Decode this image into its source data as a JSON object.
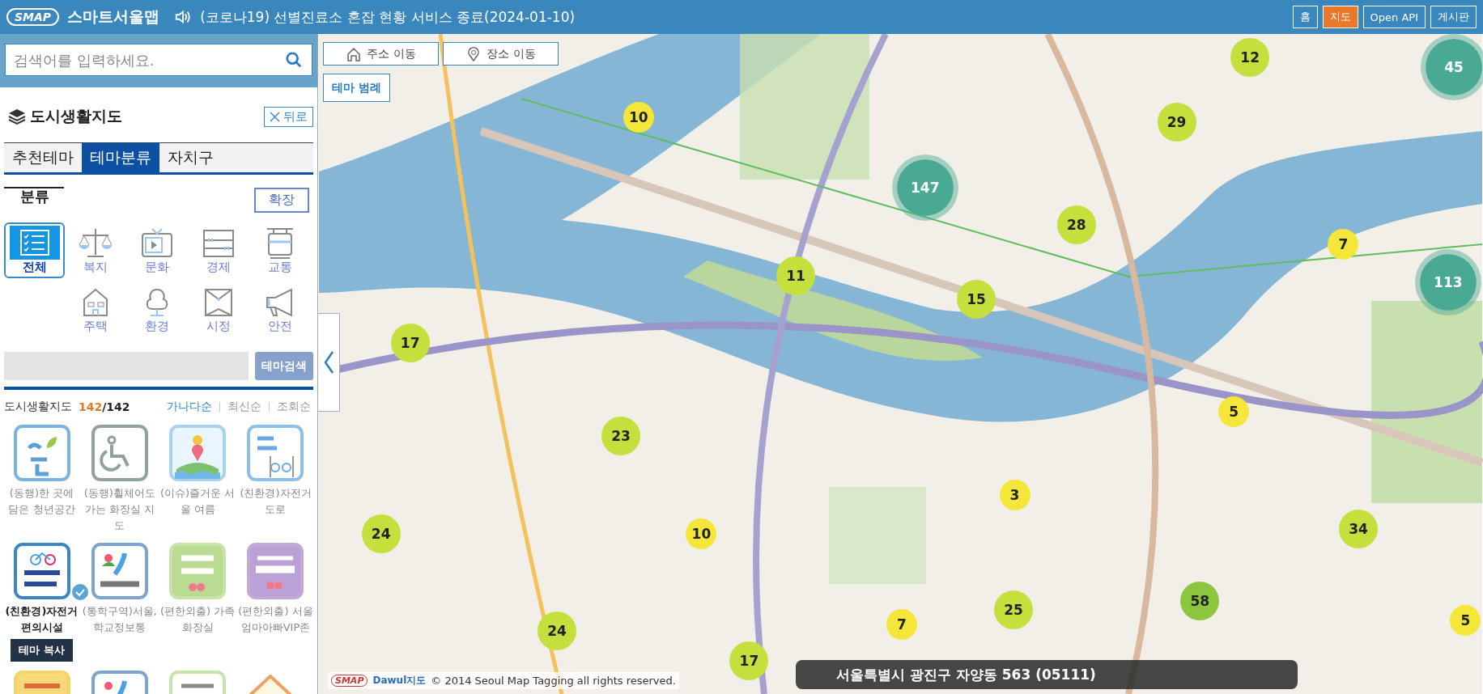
{
  "header": {
    "logo": "SMAP",
    "app_name": "스마트서울맵",
    "notice": "(코로나19) 선별진료소 혼잡 현황 서비스 종료(2024-01-10)",
    "nav": [
      {
        "label": "홈",
        "selected": false
      },
      {
        "label": "지도",
        "selected": true
      },
      {
        "label": "Open API",
        "selected": false
      },
      {
        "label": "게시판",
        "selected": false
      }
    ]
  },
  "sidebar": {
    "search": {
      "placeholder": "검색어를 입력하세요."
    },
    "title": "도시생활지도",
    "back_button": "뒤로",
    "tabs": [
      {
        "label": "추천테마",
        "selected": false
      },
      {
        "label": "테마분류",
        "selected": true
      },
      {
        "label": "자치구",
        "selected": false
      }
    ],
    "category_heading": "분류",
    "expand_button": "확장",
    "categories": [
      {
        "label": "전체",
        "selected": true
      },
      {
        "label": "복지",
        "selected": false
      },
      {
        "label": "문화",
        "selected": false
      },
      {
        "label": "경제",
        "selected": false
      },
      {
        "label": "교통",
        "selected": false
      },
      {
        "label": "주택",
        "selected": false
      },
      {
        "label": "환경",
        "selected": false
      },
      {
        "label": "시정",
        "selected": false
      },
      {
        "label": "안전",
        "selected": false
      }
    ],
    "theme_search": {
      "button": "테마검색"
    },
    "list": {
      "title": "도시생활지도",
      "count": "142",
      "total": "/142",
      "sort": [
        {
          "label": "가나다순",
          "selected": true
        },
        {
          "label": "최신순",
          "selected": false
        },
        {
          "label": "조회순",
          "selected": false
        }
      ]
    },
    "themes": [
      {
        "kind": "theme",
        "title": "(동행)한 곳에 담은 청년공간",
        "selected": false
      },
      {
        "kind": "theme",
        "title": "(동행)휠체어도 가는 화장실 지도",
        "selected": false
      },
      {
        "kind": "theme",
        "title": "(이슈)즐거운 서울 여름",
        "selected": false
      },
      {
        "kind": "theme",
        "title": "(친환경)자전거 도로",
        "selected": false
      },
      {
        "kind": "theme",
        "title": "(친환경)자전거 편의시설",
        "selected": true
      },
      {
        "kind": "theme",
        "title": "(통학구역)서울, 학교정보통",
        "selected": false
      },
      {
        "kind": "theme",
        "title": "(편한외출) 가족화장실",
        "selected": false
      },
      {
        "kind": "theme",
        "title": "(편한외출) 서울엄마아빠VIP존",
        "selected": false
      },
      {
        "kind": "partial"
      },
      {
        "kind": "partial"
      },
      {
        "kind": "partial"
      },
      {
        "kind": "partial"
      }
    ],
    "copy_button": "테마 복사"
  },
  "map": {
    "buttons": [
      {
        "label": "주소 이동"
      },
      {
        "label": "장소 이동"
      }
    ],
    "legend_button": "테마 범례",
    "clusters": [
      {
        "count": "12",
        "kind": "medium",
        "color": "#c5df3c"
      },
      {
        "count": "45",
        "kind": "large",
        "color": "#4aa993"
      },
      {
        "count": "10",
        "kind": "small",
        "color": "#f5e63a"
      },
      {
        "count": "29",
        "kind": "medium",
        "color": "#c5df3c"
      },
      {
        "count": "147",
        "kind": "large",
        "color": "#4aa993"
      },
      {
        "count": "28",
        "kind": "medium",
        "color": "#c5df3c"
      },
      {
        "count": "7",
        "kind": "small",
        "color": "#f5e63a"
      },
      {
        "count": "113",
        "kind": "large",
        "color": "#4aa993"
      },
      {
        "count": "11",
        "kind": "medium",
        "color": "#c5df3c"
      },
      {
        "count": "15",
        "kind": "medium",
        "color": "#c5df3c"
      },
      {
        "count": "17",
        "kind": "medium",
        "color": "#c5df3c"
      },
      {
        "count": "5",
        "kind": "small",
        "color": "#f5e63a"
      },
      {
        "count": "23",
        "kind": "medium",
        "color": "#c5df3c"
      },
      {
        "count": "3",
        "kind": "small",
        "color": "#f5e63a"
      },
      {
        "count": "24",
        "kind": "medium",
        "color": "#c5df3c"
      },
      {
        "count": "10",
        "kind": "small",
        "color": "#f5e63a"
      },
      {
        "count": "34",
        "kind": "medium",
        "color": "#c5df3c"
      },
      {
        "count": "58",
        "kind": "medium",
        "color": "#8cc63f"
      },
      {
        "count": "25",
        "kind": "medium",
        "color": "#c5df3c"
      },
      {
        "count": "7",
        "kind": "small",
        "color": "#f5e63a"
      },
      {
        "count": "5",
        "kind": "small",
        "color": "#f5e63a"
      },
      {
        "count": "24",
        "kind": "medium",
        "color": "#c5df3c"
      },
      {
        "count": "17",
        "kind": "medium",
        "color": "#c5df3c"
      }
    ],
    "logos": [
      "SMAP",
      "Dawul지도"
    ],
    "copyright": "© 2014 Seoul Map Tagging all rights reserved.",
    "address": "서울특별시 광진구 자양동 563 (05111)"
  }
}
